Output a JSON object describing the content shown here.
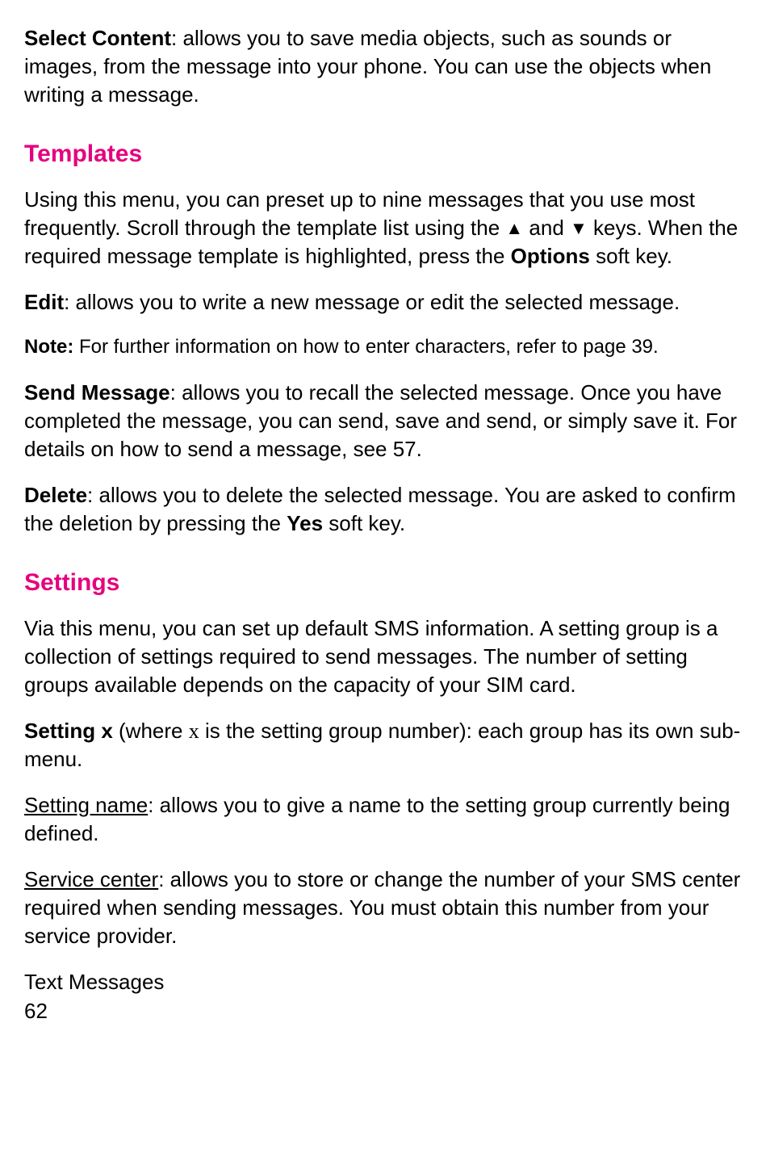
{
  "p1": {
    "bold": "Select Content",
    "text": ": allows you to save media objects, such as sounds or images, from the message into your phone. You can use the objects when writing a message."
  },
  "h1": "Templates",
  "p2": {
    "t1": "Using this menu, you can preset up to nine messages that you use most frequently. Scroll through the template list using the ",
    "arrow_up": "▲",
    "t2": " and ",
    "arrow_down": "▼",
    "t3": " keys. When the required message template is highlighted, press the ",
    "bold": "Options",
    "t4": " soft key."
  },
  "p3": {
    "bold": "Edit",
    "text": ": allows you to write a new message or edit the selected message."
  },
  "p4": {
    "bold": "Note:",
    "text": "  For further information on how to enter characters, refer to page 39."
  },
  "p5": {
    "bold": "Send Message",
    "text": ": allows you to recall the selected message. Once you have completed the message, you can send, save and send, or simply save it. For details on how to send a message, see 57."
  },
  "p6": {
    "bold": "Delete",
    "t1": ": allows you to delete the selected message. You are asked to confirm the deletion by pressing the ",
    "bold2": "Yes",
    "t2": " soft key."
  },
  "h2": "Settings",
  "p7": "Via this menu, you can set up default SMS information. A setting group is a collection of settings required to send messages. The number of setting groups available depends on the capacity of your SIM card.",
  "p8": {
    "bold": "Setting x",
    "t1": " (where ",
    "x": "x",
    "t2": " is the setting group number): each group has its own sub-menu."
  },
  "p9": {
    "underline": "Setting name",
    "text": ": allows you to give a name to the setting group currently being defined."
  },
  "p10": {
    "underline": "Service center",
    "text": ": allows you to store or change the number of your SMS center required when sending messages. You must obtain this number from your service provider."
  },
  "footer": {
    "section": "Text Messages",
    "page": "62"
  }
}
